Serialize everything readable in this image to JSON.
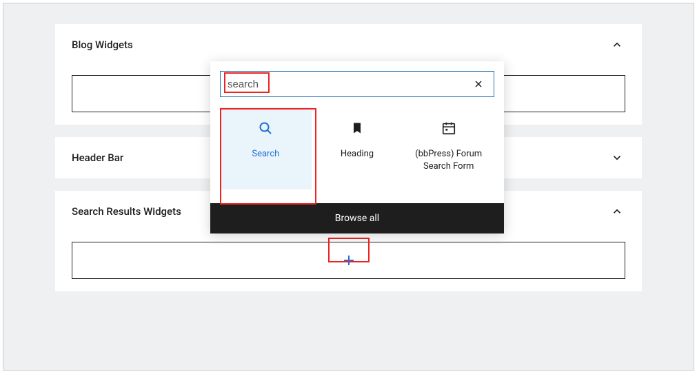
{
  "panels": {
    "blog_widgets": {
      "title": "Blog Widgets",
      "expanded": true
    },
    "header_bar": {
      "title": "Header Bar",
      "expanded": false
    },
    "search_results_widgets": {
      "title": "Search Results Widgets",
      "expanded": true
    }
  },
  "block_inserter": {
    "search_value": "search",
    "browse_all_label": "Browse all",
    "blocks": [
      {
        "label": "Search",
        "icon": "search",
        "selected": true
      },
      {
        "label": "Heading",
        "icon": "bookmark",
        "selected": false
      },
      {
        "label": "(bbPress) Forum Search Form",
        "icon": "calendar",
        "selected": false
      }
    ]
  }
}
